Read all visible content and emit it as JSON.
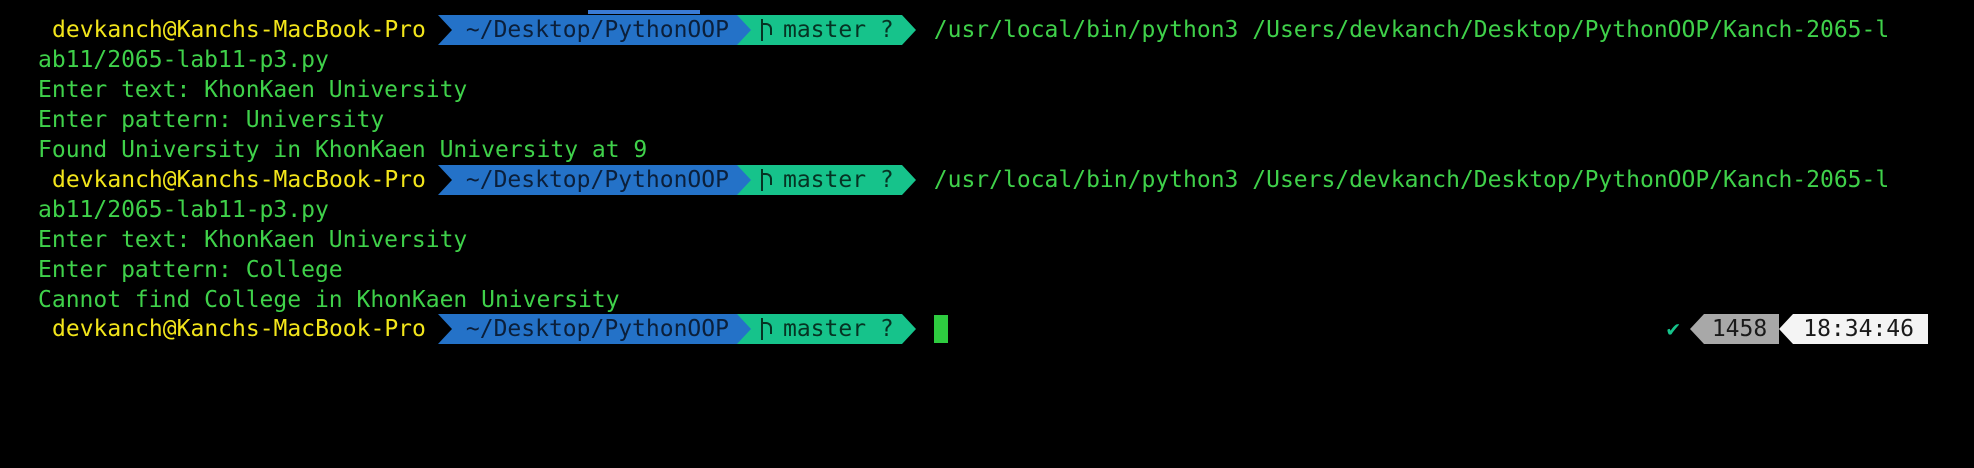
{
  "terminal": {
    "prompt": {
      "user_host": "devkanch@Kanchs-MacBook-Pro",
      "dir": "~/Desktop/PythonOOP",
      "git": "master ?"
    },
    "runs": [
      {
        "command_line1": "/usr/local/bin/python3 /Users/devkanch/Desktop/PythonOOP/Kanch-2065-l",
        "command_line2": "ab11/2065-lab11-p3.py",
        "output": [
          "Enter text: KhonKaen University",
          "Enter pattern: University",
          "Found University in KhonKaen University at 9"
        ]
      },
      {
        "command_line1": "/usr/local/bin/python3 /Users/devkanch/Desktop/PythonOOP/Kanch-2065-l",
        "command_line2": "ab11/2065-lab11-p3.py",
        "output": [
          "Enter text: KhonKaen University",
          "Enter pattern: College",
          "Cannot find College in KhonKaen University"
        ]
      }
    ],
    "right_prompt": {
      "status_icon": "check-icon",
      "count": "1458",
      "time": "18:34:46"
    },
    "colors": {
      "background": "#000000",
      "text": "#3fd14a",
      "user": "#f2e51b",
      "dir_segment": "#2472c8",
      "git_segment": "#16c38b"
    }
  }
}
